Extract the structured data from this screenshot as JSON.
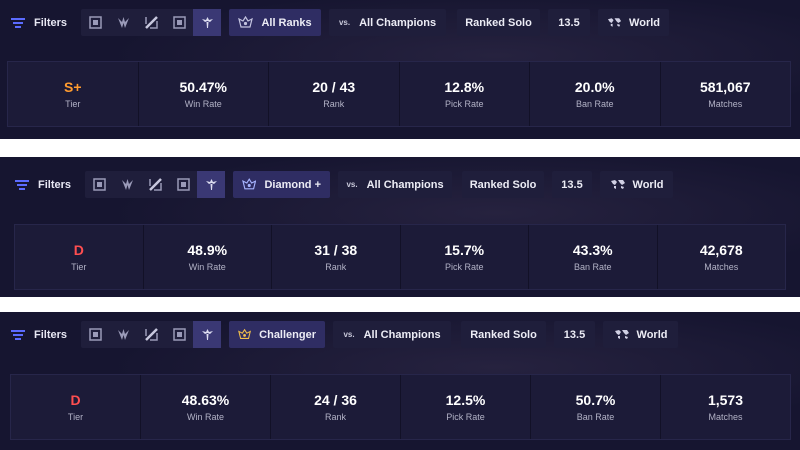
{
  "colors": {
    "panel_bg": "#161530",
    "chip_bg": "#1f1e3b",
    "active_rank_chip": "#2f2d63",
    "tier_splus": "#ff9b2f",
    "tier_d": "#ff4e50"
  },
  "panels": [
    {
      "filters_label": "Filters",
      "rank": "All Ranks",
      "vs_label": "vs.",
      "opponent": "All Champions",
      "queue": "Ranked Solo",
      "patch": "13.5",
      "region": "World",
      "stats": {
        "tier": {
          "value": "S+",
          "label": "Tier"
        },
        "win_rate": {
          "value": "50.47%",
          "label": "Win Rate"
        },
        "rank": {
          "value": "20 / 43",
          "label": "Rank"
        },
        "pick_rate": {
          "value": "12.8%",
          "label": "Pick Rate"
        },
        "ban_rate": {
          "value": "20.0%",
          "label": "Ban Rate"
        },
        "matches": {
          "value": "581,067",
          "label": "Matches"
        }
      }
    },
    {
      "filters_label": "Filters",
      "rank": "Diamond +",
      "vs_label": "vs.",
      "opponent": "All Champions",
      "queue": "Ranked Solo",
      "patch": "13.5",
      "region": "World",
      "stats": {
        "tier": {
          "value": "D",
          "label": "Tier"
        },
        "win_rate": {
          "value": "48.9%",
          "label": "Win Rate"
        },
        "rank": {
          "value": "31 / 38",
          "label": "Rank"
        },
        "pick_rate": {
          "value": "15.7%",
          "label": "Pick Rate"
        },
        "ban_rate": {
          "value": "43.3%",
          "label": "Ban Rate"
        },
        "matches": {
          "value": "42,678",
          "label": "Matches"
        }
      }
    },
    {
      "filters_label": "Filters",
      "rank": "Challenger",
      "vs_label": "vs.",
      "opponent": "All Champions",
      "queue": "Ranked Solo",
      "patch": "13.5",
      "region": "World",
      "stats": {
        "tier": {
          "value": "D",
          "label": "Tier"
        },
        "win_rate": {
          "value": "48.63%",
          "label": "Win Rate"
        },
        "rank": {
          "value": "24 / 36",
          "label": "Rank"
        },
        "pick_rate": {
          "value": "12.5%",
          "label": "Pick Rate"
        },
        "ban_rate": {
          "value": "50.7%",
          "label": "Ban Rate"
        },
        "matches": {
          "value": "1,573",
          "label": "Matches"
        }
      }
    }
  ],
  "role_icons": [
    "top-role-icon",
    "jungle-role-icon",
    "mid-role-icon",
    "bottom-role-icon",
    "support-role-icon"
  ],
  "active_role": "support-role-icon"
}
